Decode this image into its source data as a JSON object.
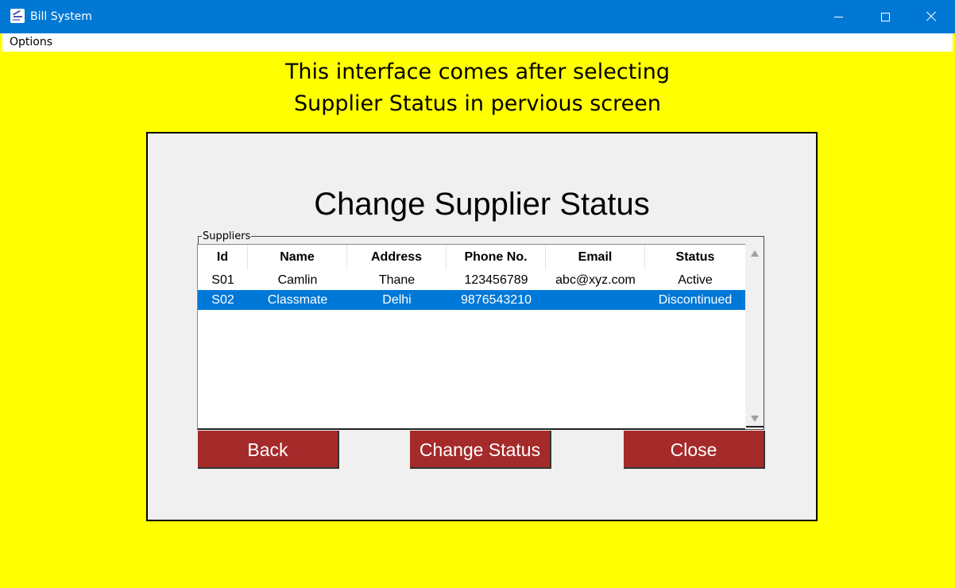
{
  "window": {
    "title": "Bill System",
    "icon": "app-icon"
  },
  "colors": {
    "titlebar": "#0078d4",
    "background": "#ffff00",
    "button": "#a52a2a",
    "selection": "#0078d7"
  },
  "menu": {
    "items": [
      "Options"
    ]
  },
  "heading": {
    "line1": "This interface comes after selecting",
    "line2": "Supplier Status in pervious screen"
  },
  "panel": {
    "title": "Change Supplier Status",
    "group_label": "Suppliers",
    "table": {
      "columns": [
        "Id",
        "Name",
        "Address",
        "Phone No.",
        "Email",
        "Status"
      ],
      "rows": [
        [
          "S01",
          "Camlin",
          "Thane",
          "123456789",
          "abc@xyz.com",
          "Active"
        ],
        [
          "S02",
          "Classmate",
          "Delhi",
          "9876543210",
          "",
          "Discontinued"
        ]
      ],
      "selected_row": 1
    },
    "buttons": {
      "back": "Back",
      "change_status": "Change Status",
      "close": "Close"
    }
  }
}
